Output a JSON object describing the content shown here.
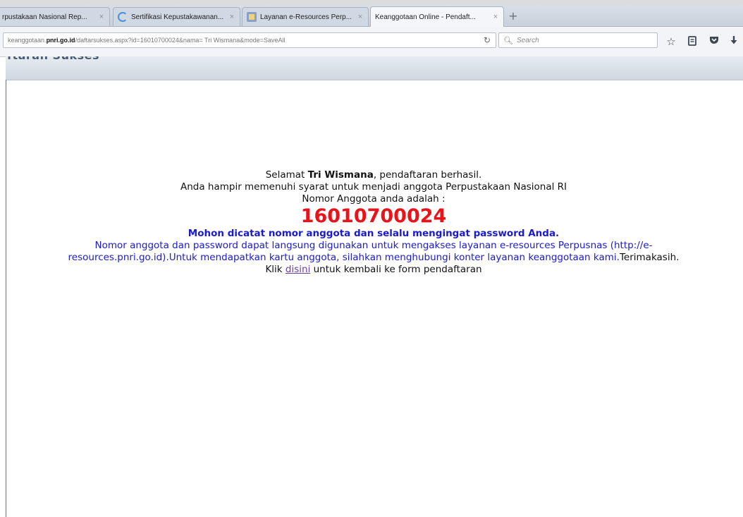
{
  "browser": {
    "tabs": [
      {
        "label": "rpustakaan Nasional Rep..."
      },
      {
        "label": "Sertifikasi Kepustakawanan..."
      },
      {
        "label": "Layanan e-Resources Perp..."
      },
      {
        "label": "Keanggotaan Online - Pendaft..."
      }
    ],
    "close_glyph": "×",
    "new_tab_glyph": "+",
    "url": {
      "prefix": "keanggotaan.",
      "domain": "pnri.go.id",
      "path": "/daftarsukses.aspx?id=16010700024&nama= Tri Wismana&mode=SaveAll"
    },
    "search_placeholder": "Search",
    "toolbar_icons": [
      "bookmark-star-icon",
      "reading-list-icon",
      "pocket-icon",
      "download-icon"
    ]
  },
  "page": {
    "heading": "ftaran Sukses",
    "greeting_prefix": "Selamat ",
    "user_name": "Tri Wismana",
    "greeting_suffix": ", pendaftaran berhasil.",
    "eligibility": "Anda hampir memenuhi syarat untuk menjadi anggota Perpustakaan Nasional RI",
    "number_label": "Nomor Anggota anda adalah :",
    "member_number": "16010700024",
    "remember_note": "Mohon dicatat nomor anggota dan selalu mengingat password Anda.",
    "info_line1": "Nomor anggota dan password dapat langsung digunakan untuk mengakses layanan e-resources Perpusnas (http://e-",
    "info_line2": "resources.pnri.go.id).Untuk mendapatkan kartu anggota, silahkan menghubungi konter layanan keanggotaan kami.",
    "thanks": "Terimakasih.",
    "back_prefix": "Klik ",
    "back_link": "disini",
    "back_suffix": " untuk kembali ke form pendaftaran"
  }
}
